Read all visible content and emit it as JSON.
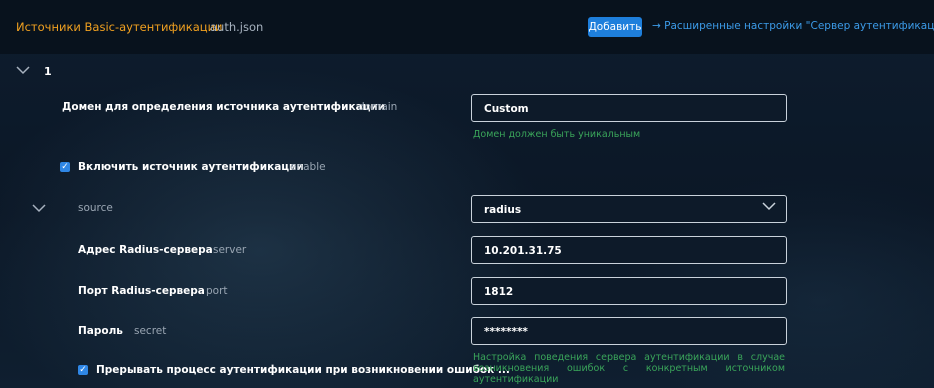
{
  "header": {
    "title": "Источники Basic-аутентификации",
    "file": "auth.json",
    "add_button": "Добавить",
    "advanced_link": "→ Расширенные настройки \"Сервер аутентификации\""
  },
  "item": {
    "number": "1",
    "domain": {
      "label": "Домен для определения источника аутентификации",
      "key": "domain",
      "value": "Custom",
      "hint": "Домен должен быть уникальным"
    },
    "enable": {
      "label": "Включить источник аутентификации",
      "key": "enable",
      "checked": true
    },
    "source": {
      "key": "source",
      "value": "radius",
      "server": {
        "label": "Адрес Radius-сервера",
        "key": "server",
        "value": "10.201.31.75"
      },
      "port": {
        "label": "Порт Radius-сервера",
        "key": "port",
        "value": "1812"
      },
      "secret": {
        "label": "Пароль",
        "key": "secret",
        "value": "********"
      },
      "abort": {
        "label": "Прерывать процесс аутентификации при возникновении ошибок ...",
        "checked": true,
        "hint": "Настройка поведения сервера аутентификации в случае возникновения ошибок с конкретным источником аутентификации"
      }
    }
  },
  "colors": {
    "title_accent": "#f0a020",
    "button_blue": "#1e7fdc",
    "link_blue": "#3c9be8",
    "hint_green": "#3aa55a",
    "background": "#0c1a2a"
  }
}
